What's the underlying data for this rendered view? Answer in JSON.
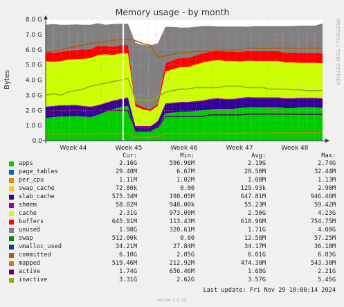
{
  "chart_data": {
    "type": "area",
    "title": "Memory usage - by month",
    "ylabel": "Bytes",
    "side_text": "RRDTOOL / TOBI OETIKER",
    "y_ticks": [
      "0.0",
      "1.0 G",
      "2.0 G",
      "3.0 G",
      "4.0 G",
      "5.0 G",
      "6.0 G",
      "7.0 G",
      "8.0 G"
    ],
    "ylim": [
      0,
      8
    ],
    "x_ticks": [
      "Week 44",
      "Week 45",
      "Week 46",
      "Week 47",
      "Week 48"
    ],
    "x_tick_positions": [
      0.5,
      1.5,
      2.5,
      3.5,
      4.5
    ],
    "xlim": [
      0,
      5
    ],
    "grid": true,
    "legend_headers": {
      "cur": "Cur:",
      "min": "Min:",
      "avg": "Avg:",
      "max": "Max:"
    },
    "series": [
      {
        "name": "apps",
        "color": "#00cc00",
        "cur": "2.16G",
        "min": "596.96M",
        "avg": "2.19G",
        "max": "2.74G"
      },
      {
        "name": "page_tables",
        "color": "#0066b3",
        "cur": "29.48M",
        "min": "6.67M",
        "avg": "28.50M",
        "max": "32.44M"
      },
      {
        "name": "per_cpu",
        "color": "#ff8000",
        "cur": "1.11M",
        "min": "1.02M",
        "avg": "1.08M",
        "max": "1.13M"
      },
      {
        "name": "swap_cache",
        "color": "#ffcc00",
        "cur": "72.00k",
        "min": "0.00",
        "avg": "129.93k",
        "max": "2.90M"
      },
      {
        "name": "slab_cache",
        "color": "#330099",
        "cur": "575.34M",
        "min": "198.05M",
        "avg": "647.81M",
        "max": "946.46M"
      },
      {
        "name": "shmem",
        "color": "#990099",
        "cur": "58.82M",
        "min": "948.00k",
        "avg": "55.23M",
        "max": "59.42M"
      },
      {
        "name": "cache",
        "color": "#ccff00",
        "cur": "2.31G",
        "min": "973.09M",
        "avg": "2.50G",
        "max": "4.23G"
      },
      {
        "name": "buffers",
        "color": "#ff0000",
        "cur": "645.91M",
        "min": "113.43M",
        "avg": "618.96M",
        "max": "754.75M"
      },
      {
        "name": "unused",
        "color": "#808080",
        "cur": "1.98G",
        "min": "320.61M",
        "avg": "1.71G",
        "max": "4.00G"
      },
      {
        "name": "swap",
        "color": "#008f00",
        "cur": "512.00k",
        "min": "0.00",
        "avg": "12.58M",
        "max": "57.25M"
      },
      {
        "name": "vmalloc_used",
        "color": "#00487d",
        "cur": "34.21M",
        "min": "27.84M",
        "avg": "34.17M",
        "max": "36.18M"
      },
      {
        "name": "committed",
        "color": "#b35a00",
        "cur": "6.10G",
        "min": "2.85G",
        "avg": "6.01G",
        "max": "6.83G"
      },
      {
        "name": "mapped",
        "color": "#b38f00",
        "cur": "519.46M",
        "min": "212.92M",
        "avg": "474.30M",
        "max": "543.30M"
      },
      {
        "name": "active",
        "color": "#6b006b",
        "cur": "1.74G",
        "min": "656.46M",
        "avg": "1.68G",
        "max": "2.21G"
      },
      {
        "name": "inactive",
        "color": "#8fb300",
        "cur": "3.31G",
        "min": "2.62G",
        "avg": "3.57G",
        "max": "5.45G"
      }
    ],
    "stack": [
      {
        "name": "apps",
        "values": [
          1.5,
          1.55,
          1.6,
          1.6,
          1.62,
          1.6,
          1.55,
          1.7,
          1.9,
          2.1,
          2.2,
          2.3,
          0.6,
          0.6,
          0.6,
          0.9,
          1.8,
          1.85,
          1.9,
          1.9,
          1.95,
          2.0,
          2.05,
          2.1,
          2.1,
          2.1,
          2.15,
          2.2,
          2.2,
          2.2,
          2.2,
          2.2,
          2.15,
          2.15,
          2.2,
          2.2,
          2.2,
          2.16
        ]
      },
      {
        "name": "slab_cache",
        "values": [
          0.7,
          0.7,
          0.7,
          0.7,
          0.7,
          0.65,
          0.65,
          0.6,
          0.55,
          0.5,
          0.5,
          0.5,
          0.3,
          0.3,
          0.3,
          0.35,
          0.6,
          0.6,
          0.6,
          0.6,
          0.6,
          0.6,
          0.65,
          0.65,
          0.6,
          0.6,
          0.62,
          0.62,
          0.6,
          0.6,
          0.6,
          0.6,
          0.6,
          0.6,
          0.58,
          0.58,
          0.58,
          0.58
        ]
      },
      {
        "name": "shmem",
        "values": [
          0.05,
          0.05,
          0.05,
          0.05,
          0.05,
          0.05,
          0.05,
          0.05,
          0.05,
          0.05,
          0.06,
          0.06,
          0.06,
          0.06,
          0.06,
          0.06,
          0.06,
          0.06,
          0.06,
          0.06,
          0.06,
          0.06,
          0.06,
          0.06,
          0.06,
          0.06,
          0.06,
          0.06,
          0.06,
          0.06,
          0.06,
          0.06,
          0.06,
          0.06,
          0.06,
          0.06,
          0.06,
          0.06
        ]
      },
      {
        "name": "cache",
        "values": [
          3.0,
          2.9,
          2.9,
          3.0,
          3.0,
          3.1,
          3.2,
          3.3,
          3.2,
          3.0,
          3.0,
          2.9,
          1.3,
          1.1,
          1.0,
          1.0,
          2.1,
          2.2,
          2.3,
          2.3,
          2.4,
          2.5,
          2.5,
          2.5,
          2.5,
          2.5,
          2.4,
          2.4,
          2.4,
          2.4,
          2.4,
          2.4,
          2.35,
          2.35,
          2.3,
          2.3,
          2.3,
          2.31
        ]
      },
      {
        "name": "buffers",
        "values": [
          0.6,
          0.6,
          0.6,
          0.6,
          0.6,
          0.65,
          0.6,
          0.6,
          0.55,
          0.55,
          0.55,
          0.55,
          0.2,
          0.15,
          0.12,
          0.12,
          0.55,
          0.6,
          0.6,
          0.6,
          0.6,
          0.6,
          0.6,
          0.62,
          0.62,
          0.62,
          0.62,
          0.64,
          0.64,
          0.64,
          0.64,
          0.64,
          0.64,
          0.65,
          0.65,
          0.65,
          0.65,
          0.65
        ]
      },
      {
        "name": "unused",
        "values": [
          1.8,
          1.9,
          1.8,
          1.7,
          1.7,
          1.6,
          1.6,
          1.5,
          1.4,
          1.5,
          1.4,
          1.4,
          4.0,
          4.1,
          4.2,
          4.0,
          2.4,
          2.2,
          2.0,
          2.0,
          1.9,
          1.8,
          1.7,
          1.6,
          1.65,
          1.65,
          1.68,
          1.6,
          1.65,
          1.65,
          1.65,
          1.65,
          1.75,
          1.75,
          1.8,
          1.8,
          1.8,
          1.98
        ]
      }
    ],
    "lines": [
      {
        "name": "committed",
        "values": [
          5.8,
          5.9,
          6.0,
          6.1,
          6.2,
          6.3,
          6.4,
          6.5,
          6.55,
          6.6,
          6.65,
          6.7,
          6.6,
          6.4,
          6.3,
          5.5,
          5.6,
          5.7,
          5.8,
          5.8,
          5.9,
          5.9,
          5.9,
          6.0,
          6.0,
          6.0,
          6.0,
          6.1,
          6.1,
          6.05,
          6.1,
          6.1,
          6.1,
          6.1,
          6.05,
          6.1,
          6.1,
          6.1
        ]
      },
      {
        "name": "active",
        "values": [
          1.8,
          1.9,
          1.9,
          2.0,
          2.0,
          2.1,
          2.2,
          2.1,
          2.0,
          2.0,
          2.0,
          2.0,
          0.7,
          0.7,
          0.7,
          0.9,
          1.6,
          1.6,
          1.6,
          1.6,
          1.6,
          1.6,
          1.7,
          1.7,
          1.7,
          1.7,
          1.7,
          1.75,
          1.75,
          1.75,
          1.75,
          1.75,
          1.75,
          1.75,
          1.74,
          1.74,
          1.74,
          1.74
        ]
      },
      {
        "name": "inactive",
        "values": [
          3.0,
          3.1,
          3.0,
          3.2,
          3.3,
          3.4,
          3.6,
          3.7,
          3.8,
          3.9,
          4.0,
          4.1,
          2.7,
          2.65,
          2.62,
          2.9,
          3.2,
          3.3,
          3.4,
          3.4,
          3.5,
          3.5,
          3.5,
          3.5,
          3.6,
          3.6,
          3.6,
          3.5,
          3.5,
          3.5,
          3.4,
          3.4,
          3.4,
          3.35,
          3.35,
          3.3,
          3.3,
          3.31
        ]
      },
      {
        "name": "mapped",
        "values": [
          0.45,
          0.45,
          0.45,
          0.45,
          0.46,
          0.46,
          0.46,
          0.47,
          0.47,
          0.47,
          0.48,
          0.48,
          0.22,
          0.22,
          0.22,
          0.3,
          0.46,
          0.47,
          0.47,
          0.47,
          0.48,
          0.48,
          0.48,
          0.48,
          0.49,
          0.49,
          0.49,
          0.5,
          0.5,
          0.5,
          0.5,
          0.51,
          0.51,
          0.51,
          0.52,
          0.52,
          0.52,
          0.52
        ]
      }
    ],
    "cursor_x": 1.4,
    "last_update": "Last update: Fri Nov 29 10:00:14 2024",
    "footer": "Munin 2.0.75"
  }
}
